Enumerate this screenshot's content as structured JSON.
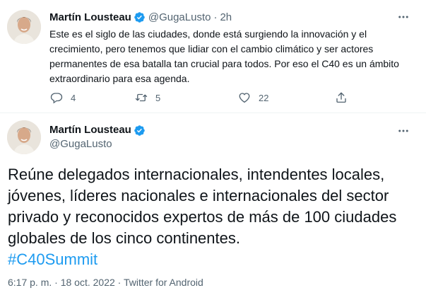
{
  "tweet1": {
    "author_name": "Martín Lousteau",
    "handle": "@GugaLusto",
    "separator": "·",
    "time": "2h",
    "text": "Este es el siglo de las ciudades, donde está surgiendo la innovación y el crecimiento, pero tenemos que lidiar con el cambio climático y ser actores permanentes de esa batalla tan crucial para todos. Por eso el C40 es un ámbito extraordinario para esa agenda.",
    "replies": "4",
    "retweets": "5",
    "likes": "22"
  },
  "tweet2": {
    "author_name": "Martín Lousteau",
    "handle": "@GugaLusto",
    "text": "Reúne delegados internacionales, intendentes locales, jóvenes, líderes nacionales e internacionales del sector privado y reconocidos expertos de más de 100 ciudades globales de los cinco continentes.",
    "hashtag": "#C40Summit",
    "time": "6:17 p. m.",
    "date": "18 oct. 2022",
    "source": "Twitter for Android",
    "meta_separator": "·"
  },
  "icons": {
    "verified": "verified-badge-icon",
    "more": "more-horizontal-icon",
    "reply": "reply-icon",
    "retweet": "retweet-icon",
    "like": "heart-icon",
    "share": "share-icon"
  },
  "colors": {
    "accent": "#1d9bf0",
    "secondary_text": "#536471",
    "primary_text": "#0f1419",
    "divider": "#eff3f4"
  }
}
